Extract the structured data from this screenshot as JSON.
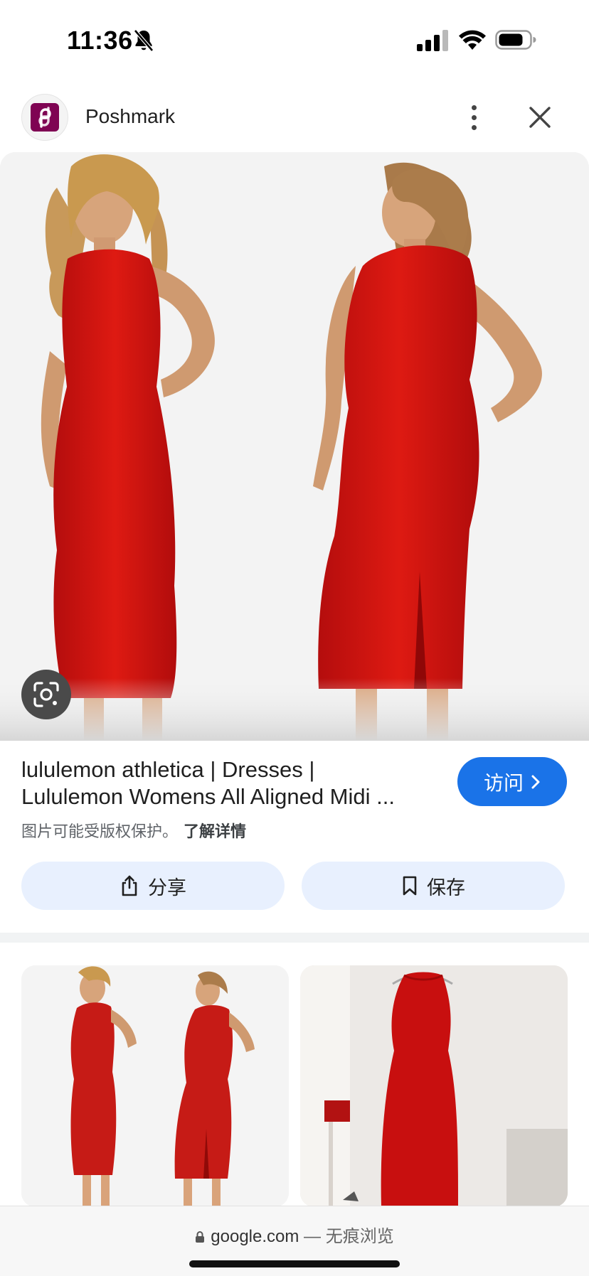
{
  "status_bar": {
    "time": "11:36",
    "icons": [
      "bell-slash-icon",
      "cellular-signal-icon",
      "wifi-icon",
      "battery-icon"
    ]
  },
  "source": {
    "name": "Poshmark",
    "logo_icon": "poshmark-logo-icon",
    "brand_color": "#7f0353"
  },
  "header_actions": {
    "more_icon": "more-vertical-icon",
    "close_icon": "close-icon"
  },
  "main_image": {
    "subject": "red-dress-photo",
    "lens_icon": "google-lens-icon"
  },
  "result": {
    "title_line1": "lululemon athletica | Dresses |",
    "title_line2": "Lululemon Womens All Aligned Midi ...",
    "visit_label": "访问",
    "visit_icon": "chevron-right-icon",
    "copyright_text": "图片可能受版权保护。",
    "learn_more_label": "了解详情",
    "accent_color": "#1a73e8"
  },
  "actions": {
    "share_label": "分享",
    "share_icon": "share-icon",
    "save_label": "保存",
    "save_icon": "bookmark-icon"
  },
  "related": {
    "items": [
      "related-image-dress-front-back",
      "related-image-dress-on-hanger"
    ]
  },
  "bottom_bar": {
    "domain": "google.com",
    "separator": " — ",
    "mode": "无痕浏览",
    "lock_icon": "lock-icon"
  }
}
